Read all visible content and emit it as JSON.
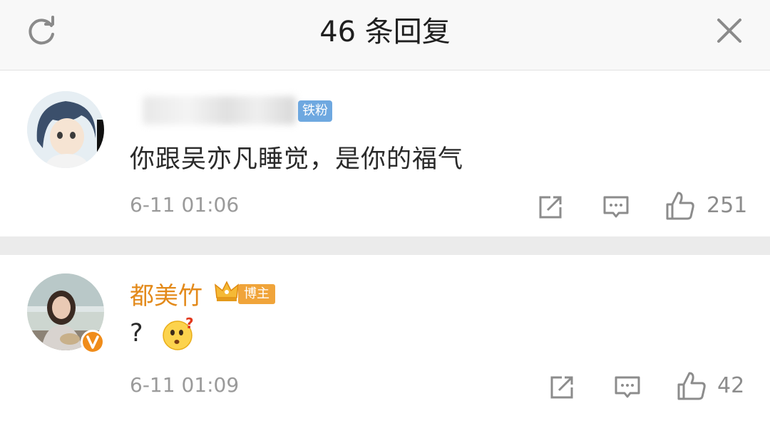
{
  "header": {
    "title": "46 条回复",
    "refresh_icon": "refresh-icon",
    "close_icon": "close-icon"
  },
  "comments": [
    {
      "badge": "铁粉",
      "text": "你跟吴亦凡睡觉，是你的福气",
      "timestamp": "6-11 01:06",
      "likes": "251",
      "actions": [
        "share-icon",
        "comment-icon",
        "thumbs-up-icon"
      ]
    },
    {
      "username": "都美竹",
      "badge": "博主",
      "text": "?",
      "emoji": "confused-face-emoji",
      "timestamp": "6-11 01:09",
      "likes": "42",
      "actions": [
        "share-icon",
        "comment-icon",
        "thumbs-up-icon"
      ]
    }
  ],
  "colors": {
    "username_orange": "#e38a1b",
    "tiefen_badge_blue": "#6ea8e0",
    "blogger_badge_orange": "#f0a43a",
    "verified_orange": "#f08c1a"
  }
}
